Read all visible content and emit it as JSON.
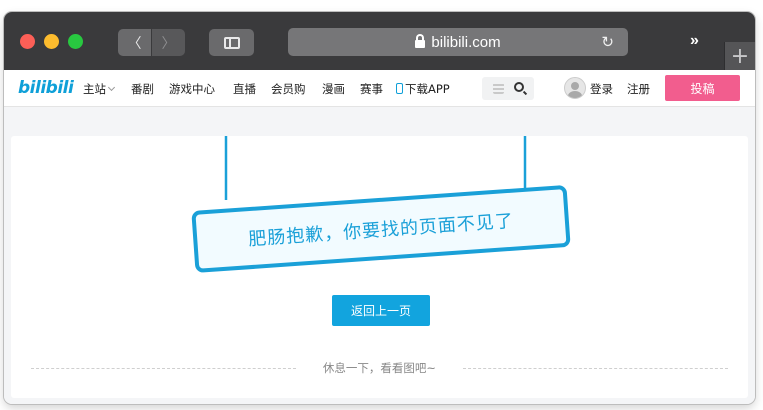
{
  "browser": {
    "address": "bilibili.com",
    "colors": {
      "close": "#fc5f57",
      "minimize": "#fdbc2e",
      "zoom": "#28c840"
    },
    "icons": [
      "back-icon",
      "forward-icon",
      "sidebar-icon",
      "lock-icon",
      "reload-icon",
      "more-icon",
      "new-tab-icon"
    ],
    "glyphs": {
      "back": "〈",
      "forward": "〉",
      "reload": "↻",
      "more": "»",
      "new_tab": "+"
    }
  },
  "nav": {
    "logo": "bilibili",
    "items": [
      "主站",
      "番剧",
      "游戏中心",
      "直播",
      "会员购",
      "漫画",
      "赛事",
      "下载APP"
    ],
    "login": "登录",
    "register": "注册",
    "upload": "投稿",
    "colors": {
      "brand": "#0fa0d8",
      "upload": "#f25d8e"
    }
  },
  "error_page": {
    "sign_text": "肥肠抱歉，你要找的页面不见了",
    "back_button": "返回上一页",
    "rest_text": "休息一下，看看图吧~",
    "colors": {
      "accent": "#12a4de"
    }
  }
}
